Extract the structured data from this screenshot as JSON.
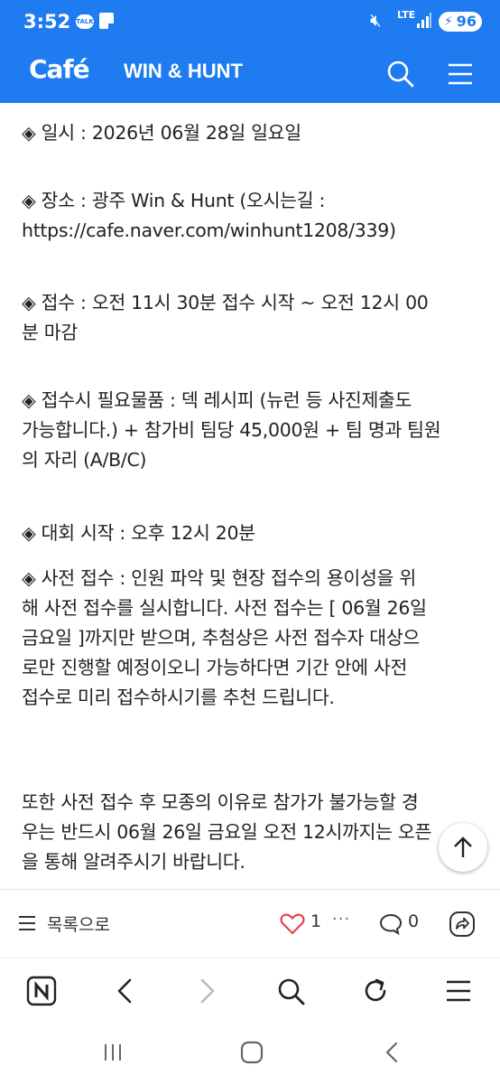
{
  "status_bar": {
    "time": "3:52",
    "talk_badge": "TALK",
    "lte_label": "LTE",
    "battery": "96",
    "colors": {
      "bar": "#1e7cf0"
    }
  },
  "app_bar": {
    "logo": "Café",
    "cafe_name": "WIN & HUNT",
    "icons": {
      "search": "search-icon",
      "menu": "hamburger-menu-icon"
    }
  },
  "article": {
    "paragraphs": [
      "◈ 일시 : 2026년 06월 28일 일요일",
      "◈ 장소 : 광주 Win & Hunt (오시는길 :\nhttps://cafe.naver.com/winhunt1208/339)",
      "◈ 접수 : 오전 11시 30분 접수 시작 ~ 오전 12시 00\n분 마감",
      "◈ 접수시 필요물품 : 덱 레시피 (뉴런 등 사진제출도\n가능합니다.) + 참가비 팀당 45,000원 + 팀 명과 팀원\n의 자리 (A/B/C)",
      "◈ 대회 시작 : 오후 12시 20분",
      "◈ 사전 접수 : 인원 파악 및 현장 접수의 용이성을 위\n해 사전 접수를 실시합니다. 사전 접수는 [ 06월 26일\n금요일 ]까지만 받으며, 추첨상은 사전 접수자 대상으\n로만 진행할 예정이오니 가능하다면 기간 안에 사전\n접수로 미리 접수하시기를 추천 드립니다.",
      "또한 사전 접수 후 모종의 이유로 참가가 불가능할 경\n우는 반드시 06월 26일 금요일 오전 12시까지는 오픈\n을 통해 알려주시기 바랍니다."
    ]
  },
  "action_bar": {
    "list_label": "목록으로",
    "like_count": "1",
    "more": "···",
    "comment_count": "0"
  }
}
